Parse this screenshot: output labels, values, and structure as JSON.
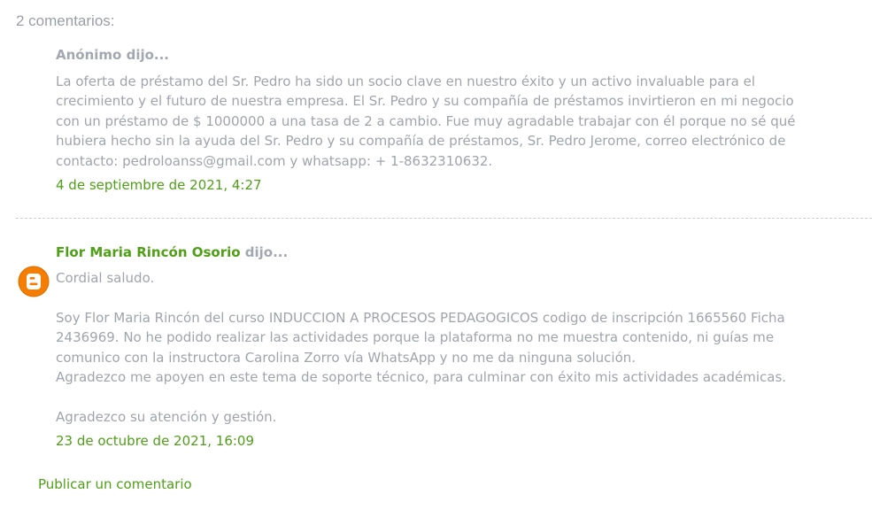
{
  "heading": "2 comentarios:",
  "comments": [
    {
      "author": "Anónimo",
      "says": " dijo...",
      "body": "La oferta de préstamo del Sr. Pedro ha sido un socio clave en nuestro éxito y un activo invaluable para el\ncrecimiento y el futuro de nuestra empresa. El Sr. Pedro y su compañía de préstamos invirtieron en mi negocio\ncon un préstamo de $ 1000000 a una tasa de 2 a cambio. Fue muy agradable trabajar con él porque no sé qué\nhubiera hecho sin la ayuda del Sr. Pedro y su compañía de préstamos, Sr. Pedro Jerome, correo electrónico de\ncontacto: pedroloanss@gmail.com y whatsapp: + 1-8632310632.",
      "timestamp": "4 de septiembre de 2021, 4:27"
    },
    {
      "author": "Flor Maria Rincón Osorio",
      "says": " dijo...",
      "body": "Cordial saludo.\n\nSoy Flor Maria Rincón del curso INDUCCION A PROCESOS PEDAGOGICOS codigo de inscripción 1665560 Ficha\n2436969. No he podido realizar las actividades porque la plataforma no me muestra contenido, ni guías me\ncomunico con la instructora Carolina Zorro vía WhatsApp y no me da ninguna solución.\nAgradezco me apoyen en este tema de soporte técnico, para culminar con éxito mis actividades académicas.\n\nAgradezco su atención y gestión.",
      "timestamp": "23 de octubre de 2021, 16:09",
      "avatar_icon": "blogger-icon"
    }
  ],
  "post_comment_label": "Publicar un comentario",
  "colors": {
    "link_green": "#4f9f17",
    "text_gray": "#a0a4ab",
    "blogger_orange": "#f57d00"
  }
}
